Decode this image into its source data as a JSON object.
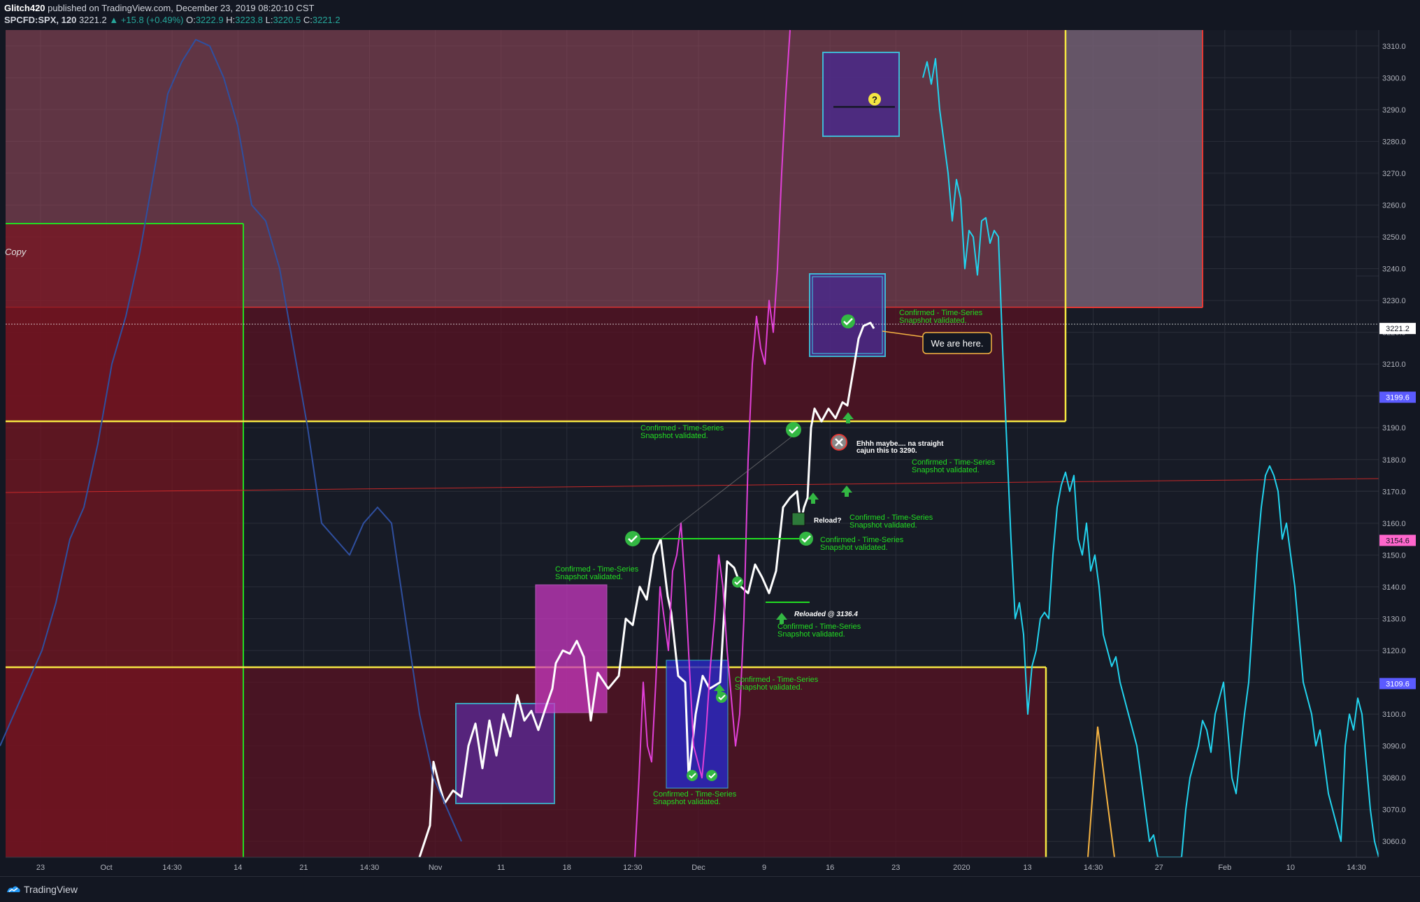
{
  "header": {
    "publisher": "Glitch420",
    "published_text": "published on TradingView.com, December 23, 2019 08:20:10 CST",
    "symbol": "SPCFD:SPX, 120",
    "last": "3221.2",
    "change": "+15.8 (+0.49%)",
    "o_label": "O:",
    "o_value": "3222.9",
    "h_label": "H:",
    "h_value": "3223.8",
    "l_label": "L:",
    "l_value": "3220.5",
    "c_label": "C:",
    "c_value": "3221.2"
  },
  "footer": {
    "brand": "TradingView"
  },
  "colors": {
    "background": "#131722",
    "price_line": "#ffffff",
    "future_line": "#22d3ee",
    "magenta": "#e040d8",
    "navy_line": "#2f4f9f",
    "yellow": "#f5e642",
    "green": "#22dd22",
    "red": "#e53935",
    "annotation": "#22dd22"
  },
  "chart_data": {
    "type": "line",
    "ylim": [
      3055,
      3315
    ],
    "y_ticks": [
      "3310.0",
      "3300.0",
      "3290.0",
      "3280.0",
      "3270.0",
      "3260.0",
      "3250.0",
      "3240.0",
      "3230.0",
      "3220.0",
      "3210.0",
      "3200.0",
      "3190.0",
      "3180.0",
      "3170.0",
      "3160.0",
      "3150.0",
      "3140.0",
      "3130.0",
      "3120.0",
      "3110.0",
      "3100.0",
      "3090.0",
      "3080.0",
      "3070.0",
      "3060.0"
    ],
    "x_ticks": [
      "23",
      "Oct",
      "14:30",
      "14",
      "21",
      "14:30",
      "Nov",
      "11",
      "18",
      "12:30",
      "Dec",
      "9",
      "16",
      "23",
      "2020",
      "13",
      "14:30",
      "27",
      "Feb",
      "10",
      "14:30"
    ],
    "price_labels": [
      {
        "value": 3221.2,
        "text": "3221.2",
        "color": "#ffffff",
        "text_color": "#131722"
      },
      {
        "value": 3199.6,
        "text": "3199.6",
        "color": "#5b5bff",
        "text_color": "#ffffff"
      },
      {
        "value": 3154.6,
        "text": "3154.6",
        "color": "#ff66cc",
        "text_color": "#131722"
      },
      {
        "value": 3109.6,
        "text": "3109.6",
        "color": "#5b5bff",
        "text_color": "#ffffff"
      }
    ],
    "series": [
      {
        "color": "#ffffff",
        "points": [
          [
            600,
            3055
          ],
          [
            615,
            3065
          ],
          [
            620,
            3085
          ],
          [
            628,
            3078
          ],
          [
            636,
            3072
          ],
          [
            648,
            3076
          ],
          [
            660,
            3074
          ],
          [
            670,
            3090
          ],
          [
            680,
            3097
          ],
          [
            690,
            3083
          ],
          [
            700,
            3098
          ],
          [
            710,
            3087
          ],
          [
            720,
            3100
          ],
          [
            730,
            3093
          ],
          [
            740,
            3106
          ],
          [
            750,
            3098
          ],
          [
            760,
            3101
          ],
          [
            770,
            3095
          ],
          [
            782,
            3103
          ],
          [
            790,
            3108
          ],
          [
            795,
            3116
          ],
          [
            805,
            3120
          ],
          [
            815,
            3119
          ],
          [
            825,
            3123
          ],
          [
            835,
            3118
          ],
          [
            845,
            3098
          ],
          [
            855,
            3113
          ],
          [
            870,
            3108
          ],
          [
            885,
            3112
          ],
          [
            895,
            3130
          ],
          [
            905,
            3128
          ],
          [
            915,
            3140
          ],
          [
            925,
            3136
          ],
          [
            935,
            3150
          ],
          [
            945,
            3155
          ],
          [
            955,
            3137
          ],
          [
            960,
            3132
          ],
          [
            970,
            3112
          ],
          [
            980,
            3110
          ],
          [
            985,
            3080
          ],
          [
            995,
            3100
          ],
          [
            1005,
            3112
          ],
          [
            1015,
            3108
          ],
          [
            1030,
            3110
          ],
          [
            1040,
            3148
          ],
          [
            1050,
            3146
          ],
          [
            1060,
            3140
          ],
          [
            1070,
            3138
          ],
          [
            1080,
            3147
          ],
          [
            1090,
            3143
          ],
          [
            1100,
            3138
          ],
          [
            1110,
            3145
          ],
          [
            1120,
            3165
          ],
          [
            1130,
            3168
          ],
          [
            1140,
            3170
          ],
          [
            1145,
            3160
          ],
          [
            1150,
            3165
          ],
          [
            1155,
            3168
          ],
          [
            1160,
            3190
          ],
          [
            1165,
            3196
          ],
          [
            1175,
            3192
          ],
          [
            1185,
            3196
          ],
          [
            1195,
            3193
          ],
          [
            1205,
            3198
          ],
          [
            1212,
            3197
          ],
          [
            1222,
            3210
          ],
          [
            1228,
            3218
          ],
          [
            1235,
            3222
          ],
          [
            1245,
            3223
          ],
          [
            1250,
            3221.2
          ]
        ]
      },
      {
        "color": "#22d3ee",
        "points": [
          [
            1320,
            3300
          ],
          [
            1326,
            3305
          ],
          [
            1332,
            3298
          ],
          [
            1338,
            3306
          ],
          [
            1344,
            3290
          ],
          [
            1350,
            3280
          ],
          [
            1356,
            3270
          ],
          [
            1362,
            3255
          ],
          [
            1368,
            3268
          ],
          [
            1374,
            3262
          ],
          [
            1380,
            3240
          ],
          [
            1386,
            3252
          ],
          [
            1392,
            3250
          ],
          [
            1398,
            3238
          ],
          [
            1404,
            3255
          ],
          [
            1410,
            3256
          ],
          [
            1416,
            3248
          ],
          [
            1422,
            3252
          ],
          [
            1428,
            3250
          ],
          [
            1434,
            3215
          ],
          [
            1440,
            3185
          ],
          [
            1446,
            3155
          ],
          [
            1452,
            3130
          ],
          [
            1458,
            3135
          ],
          [
            1464,
            3125
          ],
          [
            1470,
            3100
          ],
          [
            1476,
            3115
          ],
          [
            1482,
            3120
          ],
          [
            1488,
            3130
          ],
          [
            1494,
            3132
          ],
          [
            1500,
            3130
          ],
          [
            1506,
            3150
          ],
          [
            1512,
            3165
          ],
          [
            1518,
            3172
          ],
          [
            1524,
            3176
          ],
          [
            1530,
            3170
          ],
          [
            1536,
            3175
          ],
          [
            1542,
            3155
          ],
          [
            1548,
            3150
          ],
          [
            1554,
            3160
          ],
          [
            1560,
            3145
          ],
          [
            1566,
            3150
          ],
          [
            1572,
            3140
          ],
          [
            1578,
            3125
          ],
          [
            1584,
            3120
          ],
          [
            1590,
            3115
          ],
          [
            1596,
            3118
          ],
          [
            1602,
            3110
          ],
          [
            1608,
            3105
          ],
          [
            1614,
            3100
          ],
          [
            1620,
            3095
          ],
          [
            1626,
            3090
          ],
          [
            1632,
            3080
          ],
          [
            1638,
            3070
          ],
          [
            1644,
            3060
          ],
          [
            1650,
            3062
          ],
          [
            1656,
            3055
          ],
          [
            1690,
            3055
          ],
          [
            1696,
            3070
          ],
          [
            1702,
            3080
          ],
          [
            1708,
            3085
          ],
          [
            1714,
            3090
          ],
          [
            1720,
            3098
          ],
          [
            1726,
            3095
          ],
          [
            1732,
            3088
          ],
          [
            1738,
            3100
          ],
          [
            1744,
            3105
          ],
          [
            1750,
            3110
          ],
          [
            1756,
            3095
          ],
          [
            1762,
            3080
          ],
          [
            1768,
            3075
          ],
          [
            1774,
            3088
          ],
          [
            1780,
            3100
          ],
          [
            1786,
            3110
          ],
          [
            1792,
            3130
          ],
          [
            1798,
            3150
          ],
          [
            1804,
            3165
          ],
          [
            1810,
            3175
          ],
          [
            1816,
            3178
          ],
          [
            1822,
            3175
          ],
          [
            1828,
            3170
          ],
          [
            1834,
            3155
          ],
          [
            1840,
            3160
          ],
          [
            1846,
            3150
          ],
          [
            1852,
            3140
          ],
          [
            1858,
            3125
          ],
          [
            1864,
            3110
          ],
          [
            1870,
            3105
          ],
          [
            1876,
            3100
          ],
          [
            1882,
            3090
          ],
          [
            1888,
            3095
          ],
          [
            1894,
            3085
          ],
          [
            1900,
            3075
          ],
          [
            1906,
            3070
          ],
          [
            1912,
            3065
          ],
          [
            1918,
            3060
          ],
          [
            1924,
            3090
          ],
          [
            1930,
            3100
          ],
          [
            1936,
            3095
          ],
          [
            1942,
            3105
          ],
          [
            1948,
            3100
          ],
          [
            1954,
            3085
          ],
          [
            1960,
            3070
          ],
          [
            1966,
            3060
          ],
          [
            1972,
            3055
          ]
        ]
      },
      {
        "color": "#e040d8",
        "points": [
          [
            908,
            3055
          ],
          [
            914,
            3080
          ],
          [
            920,
            3110
          ],
          [
            926,
            3090
          ],
          [
            932,
            3085
          ],
          [
            938,
            3110
          ],
          [
            944,
            3140
          ],
          [
            950,
            3130
          ],
          [
            956,
            3120
          ],
          [
            962,
            3145
          ],
          [
            968,
            3150
          ],
          [
            974,
            3160
          ],
          [
            980,
            3140
          ],
          [
            986,
            3115
          ],
          [
            992,
            3090
          ],
          [
            998,
            3085
          ],
          [
            1004,
            3080
          ],
          [
            1010,
            3095
          ],
          [
            1016,
            3115
          ],
          [
            1022,
            3130
          ],
          [
            1028,
            3150
          ],
          [
            1034,
            3140
          ],
          [
            1040,
            3120
          ],
          [
            1046,
            3105
          ],
          [
            1052,
            3090
          ],
          [
            1058,
            3100
          ],
          [
            1064,
            3130
          ],
          [
            1070,
            3180
          ],
          [
            1076,
            3210
          ],
          [
            1082,
            3225
          ],
          [
            1088,
            3215
          ],
          [
            1094,
            3210
          ],
          [
            1100,
            3230
          ],
          [
            1106,
            3220
          ],
          [
            1112,
            3240
          ],
          [
            1118,
            3270
          ],
          [
            1124,
            3295
          ],
          [
            1130,
            3315
          ]
        ]
      },
      {
        "color": "#2f4f9f",
        "points": [
          [
            0,
            3090
          ],
          [
            20,
            3100
          ],
          [
            40,
            3110
          ],
          [
            60,
            3120
          ],
          [
            80,
            3135
          ],
          [
            100,
            3155
          ],
          [
            120,
            3165
          ],
          [
            140,
            3185
          ],
          [
            160,
            3210
          ],
          [
            180,
            3225
          ],
          [
            200,
            3245
          ],
          [
            220,
            3270
          ],
          [
            240,
            3295
          ],
          [
            260,
            3305
          ],
          [
            280,
            3312
          ],
          [
            300,
            3310
          ],
          [
            320,
            3300
          ],
          [
            340,
            3285
          ],
          [
            360,
            3260
          ],
          [
            380,
            3255
          ],
          [
            400,
            3240
          ],
          [
            420,
            3215
          ],
          [
            440,
            3190
          ],
          [
            460,
            3160
          ],
          [
            480,
            3155
          ],
          [
            500,
            3150
          ],
          [
            520,
            3160
          ],
          [
            540,
            3165
          ],
          [
            560,
            3160
          ],
          [
            580,
            3130
          ],
          [
            600,
            3100
          ],
          [
            620,
            3080
          ],
          [
            640,
            3070
          ],
          [
            660,
            3060
          ]
        ]
      }
    ]
  },
  "annotations": {
    "copy_label": "Copy",
    "we_are_here": "We are here.",
    "confirmed_line1": "Confirmed - Time-Series",
    "confirmed_line2": "Snapshot validated.",
    "ehhh_line1": "Ehhh maybe.... na straight",
    "ehhh_line2": "cajun this to 3290.",
    "reload_q": "Reload?",
    "reloaded": "Reloaded @ 3136.4",
    "question_mark": "?"
  }
}
